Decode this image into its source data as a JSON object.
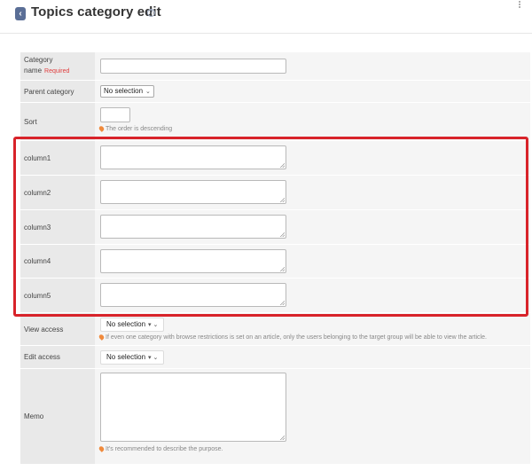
{
  "header": {
    "back_icon": "chevron-left-icon",
    "title": "Topics category edit",
    "help_icon": "question-circle-icon",
    "more_icon": "kebab-icon"
  },
  "form": {
    "category_name": {
      "label_line1": "Category",
      "label_line2": "name",
      "required": "Required",
      "value": ""
    },
    "parent_category": {
      "label": "Parent category",
      "selected": "No selection"
    },
    "sort": {
      "label": "Sort",
      "value": "",
      "hint": "The order is descending"
    },
    "columns": [
      {
        "label": "column1",
        "value": ""
      },
      {
        "label": "column2",
        "value": ""
      },
      {
        "label": "column3",
        "value": ""
      },
      {
        "label": "column4",
        "value": ""
      },
      {
        "label": "column5",
        "value": ""
      }
    ],
    "view_access": {
      "label": "View access",
      "selected": "No selection",
      "hint": "If even one category with browse restrictions is set on an article, only the users belonging to the target group will be able to view the article."
    },
    "edit_access": {
      "label": "Edit access",
      "selected": "No selection"
    },
    "memo": {
      "label": "Memo",
      "value": "",
      "hint": "It's recommended to describe the purpose."
    }
  },
  "colors": {
    "highlight": "#d8232a",
    "required": "#e04040",
    "hint_pin": "#f08a3c",
    "back_button": "#5a6e96"
  }
}
